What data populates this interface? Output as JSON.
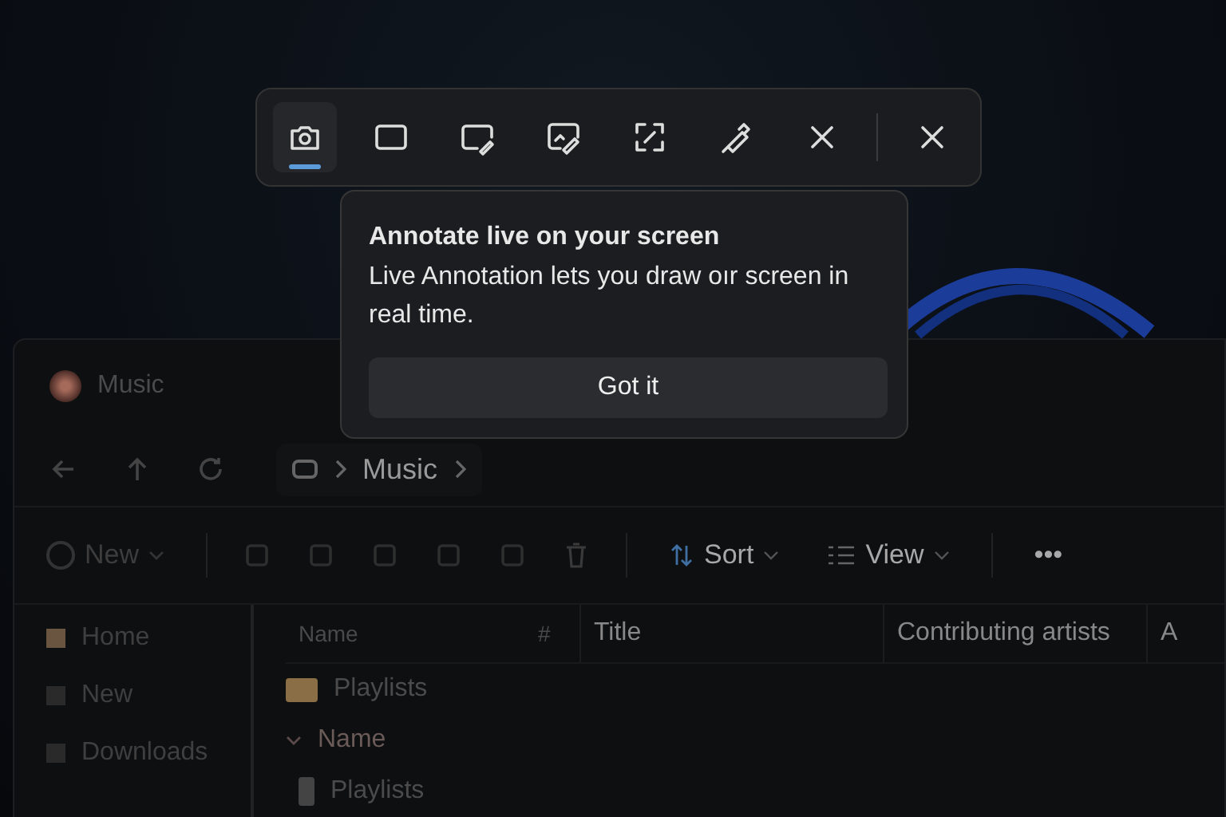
{
  "toolbar": {
    "tools": [
      {
        "selected": true
      },
      {
        "selected": false
      },
      {
        "selected": false
      },
      {
        "selected": false
      },
      {
        "selected": false
      },
      {
        "selected": false
      },
      {
        "selected": false
      },
      {
        "selected": false
      }
    ]
  },
  "popup": {
    "title": "Annotate live on your screen",
    "body": "Live Annotation lets you draw oır screen in real time.",
    "button": "Got it"
  },
  "explorer": {
    "window_title": "Music",
    "breadcrumb": [
      "Music"
    ],
    "command_bar": {
      "new": "New",
      "sort": "Sort",
      "view": "View",
      "more": "•••"
    },
    "sidebar": {
      "items": [
        {
          "label": "Home"
        },
        {
          "label": "New"
        },
        {
          "label": "Downloads"
        }
      ]
    },
    "table": {
      "columns": [
        "Name",
        "#",
        "Title",
        "Contributing artists",
        "A"
      ],
      "rows": [
        {
          "kind": "folder",
          "label": "Playlists"
        },
        {
          "kind": "group",
          "label": "Name"
        },
        {
          "kind": "file",
          "label": "Playlists"
        }
      ]
    }
  }
}
